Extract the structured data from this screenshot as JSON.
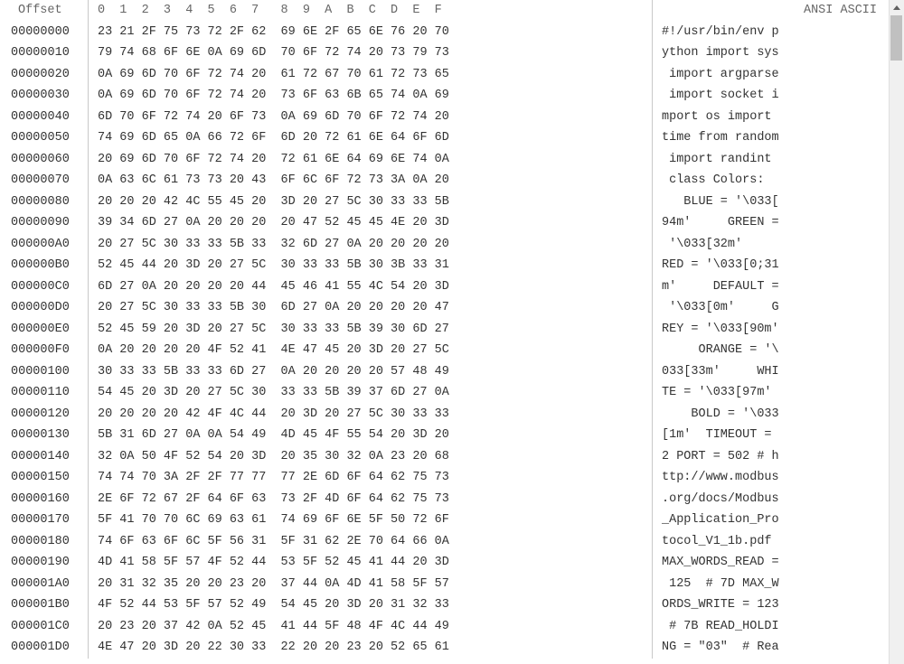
{
  "header": {
    "offset_label": "Offset",
    "hex_cols": "0  1  2  3  4  5  6  7   8  9  A  B  C  D  E  F",
    "ascii_label": "ANSI ASCII"
  },
  "rows": [
    {
      "offset": "00000000",
      "hex": "23 21 2F 75 73 72 2F 62  69 6E 2F 65 6E 76 20 70",
      "ascii": "#!/usr/bin/env p"
    },
    {
      "offset": "00000010",
      "hex": "79 74 68 6F 6E 0A 69 6D  70 6F 72 74 20 73 79 73",
      "ascii": "ython import sys"
    },
    {
      "offset": "00000020",
      "hex": "0A 69 6D 70 6F 72 74 20  61 72 67 70 61 72 73 65",
      "ascii": " import argparse"
    },
    {
      "offset": "00000030",
      "hex": "0A 69 6D 70 6F 72 74 20  73 6F 63 6B 65 74 0A 69",
      "ascii": " import socket i"
    },
    {
      "offset": "00000040",
      "hex": "6D 70 6F 72 74 20 6F 73  0A 69 6D 70 6F 72 74 20",
      "ascii": "mport os import "
    },
    {
      "offset": "00000050",
      "hex": "74 69 6D 65 0A 66 72 6F  6D 20 72 61 6E 64 6F 6D",
      "ascii": "time from random"
    },
    {
      "offset": "00000060",
      "hex": "20 69 6D 70 6F 72 74 20  72 61 6E 64 69 6E 74 0A",
      "ascii": " import randint "
    },
    {
      "offset": "00000070",
      "hex": "0A 63 6C 61 73 73 20 43  6F 6C 6F 72 73 3A 0A 20",
      "ascii": " class Colors:  "
    },
    {
      "offset": "00000080",
      "hex": "20 20 20 42 4C 55 45 20  3D 20 27 5C 30 33 33 5B",
      "ascii": "   BLUE = '\\033["
    },
    {
      "offset": "00000090",
      "hex": "39 34 6D 27 0A 20 20 20  20 47 52 45 45 4E 20 3D",
      "ascii": "94m'     GREEN ="
    },
    {
      "offset": "000000A0",
      "hex": "20 27 5C 30 33 33 5B 33  32 6D 27 0A 20 20 20 20",
      "ascii": " '\\033[32m'     "
    },
    {
      "offset": "000000B0",
      "hex": "52 45 44 20 3D 20 27 5C  30 33 33 5B 30 3B 33 31",
      "ascii": "RED = '\\033[0;31"
    },
    {
      "offset": "000000C0",
      "hex": "6D 27 0A 20 20 20 20 44  45 46 41 55 4C 54 20 3D",
      "ascii": "m'     DEFAULT ="
    },
    {
      "offset": "000000D0",
      "hex": "20 27 5C 30 33 33 5B 30  6D 27 0A 20 20 20 20 47",
      "ascii": " '\\033[0m'     G"
    },
    {
      "offset": "000000E0",
      "hex": "52 45 59 20 3D 20 27 5C  30 33 33 5B 39 30 6D 27",
      "ascii": "REY = '\\033[90m'"
    },
    {
      "offset": "000000F0",
      "hex": "0A 20 20 20 20 4F 52 41  4E 47 45 20 3D 20 27 5C",
      "ascii": "     ORANGE = '\\"
    },
    {
      "offset": "00000100",
      "hex": "30 33 33 5B 33 33 6D 27  0A 20 20 20 20 57 48 49",
      "ascii": "033[33m'     WHI"
    },
    {
      "offset": "00000110",
      "hex": "54 45 20 3D 20 27 5C 30  33 33 5B 39 37 6D 27 0A",
      "ascii": "TE = '\\033[97m' "
    },
    {
      "offset": "00000120",
      "hex": "20 20 20 20 42 4F 4C 44  20 3D 20 27 5C 30 33 33",
      "ascii": "    BOLD = '\\033"
    },
    {
      "offset": "00000130",
      "hex": "5B 31 6D 27 0A 0A 54 49  4D 45 4F 55 54 20 3D 20",
      "ascii": "[1m'  TIMEOUT = "
    },
    {
      "offset": "00000140",
      "hex": "32 0A 50 4F 52 54 20 3D  20 35 30 32 0A 23 20 68",
      "ascii": "2 PORT = 502 # h"
    },
    {
      "offset": "00000150",
      "hex": "74 74 70 3A 2F 2F 77 77  77 2E 6D 6F 64 62 75 73",
      "ascii": "ttp://www.modbus"
    },
    {
      "offset": "00000160",
      "hex": "2E 6F 72 67 2F 64 6F 63  73 2F 4D 6F 64 62 75 73",
      "ascii": ".org/docs/Modbus"
    },
    {
      "offset": "00000170",
      "hex": "5F 41 70 70 6C 69 63 61  74 69 6F 6E 5F 50 72 6F",
      "ascii": "_Application_Pro"
    },
    {
      "offset": "00000180",
      "hex": "74 6F 63 6F 6C 5F 56 31  5F 31 62 2E 70 64 66 0A",
      "ascii": "tocol_V1_1b.pdf "
    },
    {
      "offset": "00000190",
      "hex": "4D 41 58 5F 57 4F 52 44  53 5F 52 45 41 44 20 3D",
      "ascii": "MAX_WORDS_READ ="
    },
    {
      "offset": "000001A0",
      "hex": "20 31 32 35 20 20 23 20  37 44 0A 4D 41 58 5F 57",
      "ascii": " 125  # 7D MAX_W"
    },
    {
      "offset": "000001B0",
      "hex": "4F 52 44 53 5F 57 52 49  54 45 20 3D 20 31 32 33",
      "ascii": "ORDS_WRITE = 123"
    },
    {
      "offset": "000001C0",
      "hex": "20 23 20 37 42 0A 52 45  41 44 5F 48 4F 4C 44 49",
      "ascii": " # 7B READ_HOLDI"
    },
    {
      "offset": "000001D0",
      "hex": "4E 47 20 3D 20 22 30 33  22 20 20 23 20 52 65 61",
      "ascii": "NG = \"03\"  # Rea"
    }
  ]
}
